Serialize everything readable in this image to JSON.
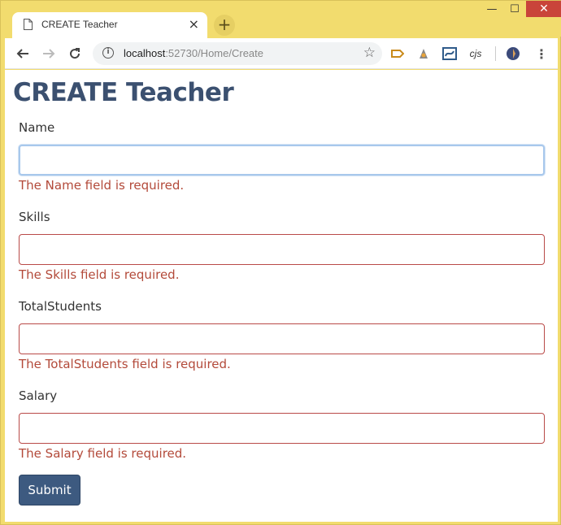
{
  "browser": {
    "tab_title": "CREATE Teacher",
    "tab_close": "×",
    "new_tab": "+",
    "url_host": "localhost",
    "url_path": ":52730/Home/Create",
    "ext_cjs": "cjs",
    "window_controls": {
      "minimize": "—",
      "maximize": "☐",
      "close": "✕"
    }
  },
  "page": {
    "title": "CREATE Teacher",
    "fields": [
      {
        "label": "Name",
        "value": "",
        "error": "The Name field is required."
      },
      {
        "label": "Skills",
        "value": "",
        "error": "The Skills field is required."
      },
      {
        "label": "TotalStudents",
        "value": "",
        "error": "The TotalStudents field is required."
      },
      {
        "label": "Salary",
        "value": "",
        "error": "The Salary field is required."
      }
    ],
    "submit_label": "Submit"
  },
  "colors": {
    "chrome_frame": "#f2dc6e",
    "heading": "#3b5070",
    "error": "#b34a3a",
    "input_error_border": "#b94a48",
    "focus_ring": "#a8c8ec",
    "submit_bg": "#3d5a80"
  },
  "icons": [
    "document-icon",
    "close-icon",
    "plus-icon",
    "back-arrow-icon",
    "forward-arrow-icon",
    "reload-icon",
    "info-icon",
    "star-icon",
    "extension-icon",
    "menu-dots-icon"
  ]
}
